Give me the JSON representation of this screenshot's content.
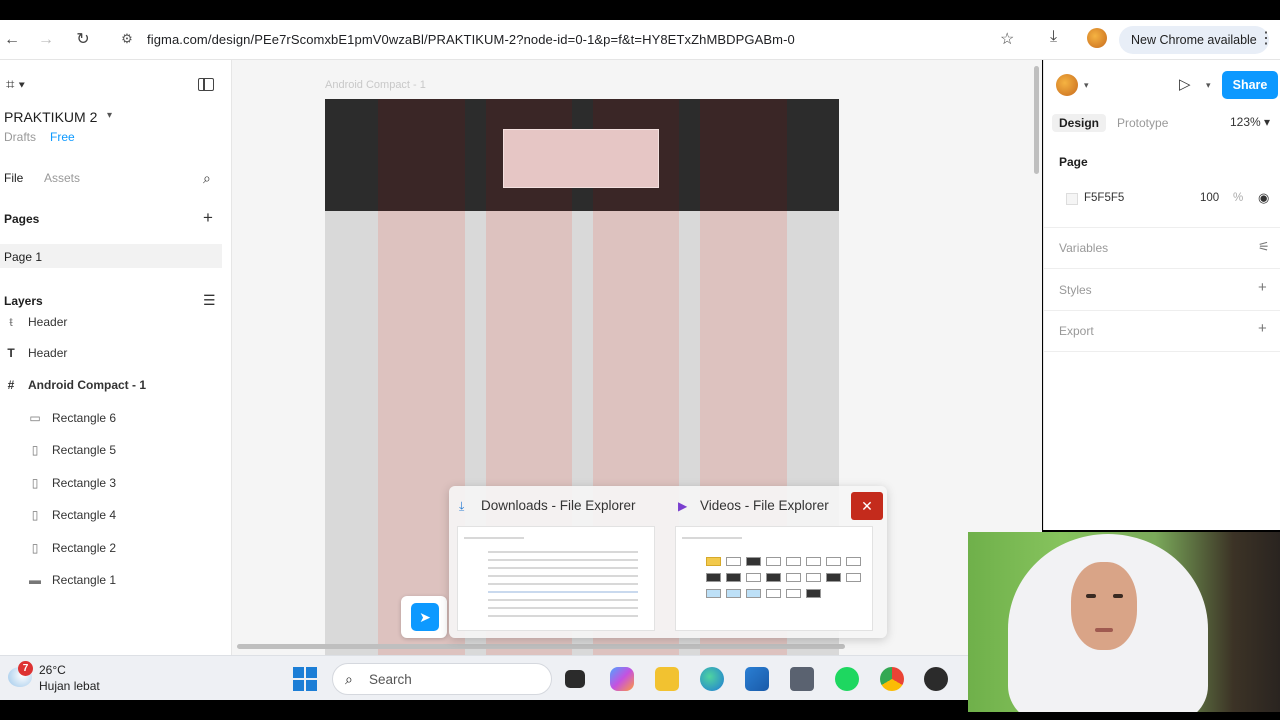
{
  "browser": {
    "url": "figma.com/design/PEe7rScomxbE1pmV0wzaBl/PRAKTIKUM-2?node-id=0-1&p=f&t=HY8ETxZhMBDPGABm-0",
    "update_label": "New Chrome available"
  },
  "left_panel": {
    "file_name": "PRAKTIKUM 2",
    "drafts_label": "Drafts",
    "plan_label": "Free",
    "tabs": {
      "file": "File",
      "assets": "Assets"
    },
    "pages_title": "Pages",
    "pages": [
      "Page 1"
    ],
    "layers_title": "Layers",
    "layers": [
      {
        "name": "Header",
        "icon": "frame-partial-icon"
      },
      {
        "name": "Header",
        "icon": "text-icon"
      },
      {
        "name": "Android Compact - 1",
        "icon": "frame-icon"
      },
      {
        "name": "Rectangle 6",
        "icon": "rectangle-icon"
      },
      {
        "name": "Rectangle 5",
        "icon": "rectangle-icon"
      },
      {
        "name": "Rectangle 3",
        "icon": "rectangle-icon"
      },
      {
        "name": "Rectangle 4",
        "icon": "rectangle-icon"
      },
      {
        "name": "Rectangle 2",
        "icon": "rectangle-icon"
      },
      {
        "name": "Rectangle 1",
        "icon": "rectangle-icon"
      }
    ]
  },
  "canvas": {
    "frame_label": "Android Compact - 1",
    "colors": {
      "canvas_bg": "#f5f5f5",
      "frame_bg": "#d9d9d9",
      "header_bg": "#2c2c2c",
      "column_fill": "#e0aeaa"
    }
  },
  "taskbar_popup": {
    "windows": [
      {
        "title": "Downloads - File Explorer",
        "icon": "download-icon"
      },
      {
        "title": "Videos - File Explorer",
        "icon": "video-icon"
      }
    ],
    "close_glyph": "✕"
  },
  "right_panel": {
    "share_label": "Share",
    "tabs": {
      "design": "Design",
      "prototype": "Prototype"
    },
    "zoom": "123%",
    "page_section": "Page",
    "background": {
      "hex": "F5F5F5",
      "opacity": "100",
      "unit": "%"
    },
    "variables_label": "Variables",
    "styles_label": "Styles",
    "export_label": "Export"
  },
  "taskbar": {
    "weather_badge": "7",
    "temperature": "26°C",
    "weather_desc": "Hujan lebat",
    "search_label": "Search"
  }
}
